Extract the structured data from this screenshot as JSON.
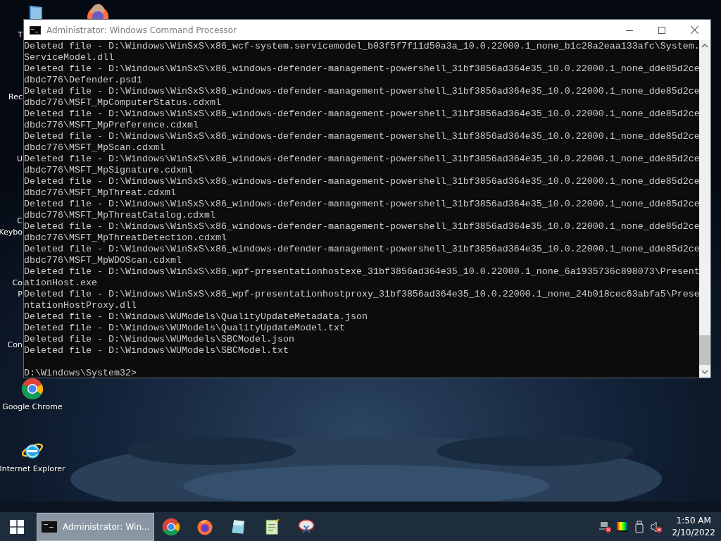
{
  "desktop_icons": [
    {
      "kind": "covered-pc",
      "label_lines": [
        "T"
      ]
    },
    {
      "kind": "covered",
      "label_lines": [
        "Rec"
      ]
    },
    {
      "kind": "covered",
      "label_lines": [
        "U"
      ]
    },
    {
      "kind": "covered",
      "label_lines": [
        "C",
        "Keybo"
      ]
    },
    {
      "kind": "covered",
      "label_lines": [
        "Co",
        "P"
      ]
    },
    {
      "kind": "covered",
      "label_lines": [
        "Con"
      ]
    },
    {
      "kind": "chrome-app",
      "label_lines": [
        "Google Chrome"
      ]
    },
    {
      "kind": "ie-app",
      "label_lines": [
        "Internet Explorer"
      ]
    }
  ],
  "window": {
    "title": "Administrator: Windows Command Processor",
    "lines": [
      "Deleted file - D:\\Windows\\WinSxS\\x86_wcf-system.servicemodel_b03f5f7f11d50a3a_10.0.22000.1_none_b1c28a2eaa133afc\\System.",
      "ServiceModel.dll",
      "Deleted file - D:\\Windows\\WinSxS\\x86_windows-defender-management-powershell_31bf3856ad364e35_10.0.22000.1_none_dde85d2ce",
      "dbdc776\\Defender.psd1",
      "Deleted file - D:\\Windows\\WinSxS\\x86_windows-defender-management-powershell_31bf3856ad364e35_10.0.22000.1_none_dde85d2ce",
      "dbdc776\\MSFT_MpComputerStatus.cdxml",
      "Deleted file - D:\\Windows\\WinSxS\\x86_windows-defender-management-powershell_31bf3856ad364e35_10.0.22000.1_none_dde85d2ce",
      "dbdc776\\MSFT_MpPreference.cdxml",
      "Deleted file - D:\\Windows\\WinSxS\\x86_windows-defender-management-powershell_31bf3856ad364e35_10.0.22000.1_none_dde85d2ce",
      "dbdc776\\MSFT_MpScan.cdxml",
      "Deleted file - D:\\Windows\\WinSxS\\x86_windows-defender-management-powershell_31bf3856ad364e35_10.0.22000.1_none_dde85d2ce",
      "dbdc776\\MSFT_MpSignature.cdxml",
      "Deleted file - D:\\Windows\\WinSxS\\x86_windows-defender-management-powershell_31bf3856ad364e35_10.0.22000.1_none_dde85d2ce",
      "dbdc776\\MSFT_MpThreat.cdxml",
      "Deleted file - D:\\Windows\\WinSxS\\x86_windows-defender-management-powershell_31bf3856ad364e35_10.0.22000.1_none_dde85d2ce",
      "dbdc776\\MSFT_MpThreatCatalog.cdxml",
      "Deleted file - D:\\Windows\\WinSxS\\x86_windows-defender-management-powershell_31bf3856ad364e35_10.0.22000.1_none_dde85d2ce",
      "dbdc776\\MSFT_MpThreatDetection.cdxml",
      "Deleted file - D:\\Windows\\WinSxS\\x86_windows-defender-management-powershell_31bf3856ad364e35_10.0.22000.1_none_dde85d2ce",
      "dbdc776\\MSFT_MpWDOScan.cdxml",
      "Deleted file - D:\\Windows\\WinSxS\\x86_wpf-presentationhostexe_31bf3856ad364e35_10.0.22000.1_none_6a1935736c898073\\Present",
      "ationHost.exe",
      "Deleted file - D:\\Windows\\WinSxS\\x86_wpf-presentationhostproxy_31bf3856ad364e35_10.0.22000.1_none_24b018cec63abfa5\\Prese",
      "ntationHostProxy.dll",
      "Deleted file - D:\\Windows\\WUModels\\QualityUpdateMetadata.json",
      "Deleted file - D:\\Windows\\WUModels\\QualityUpdateModel.txt",
      "Deleted file - D:\\Windows\\WUModels\\SBCModel.json",
      "Deleted file - D:\\Windows\\WUModels\\SBCModel.txt"
    ],
    "prompt": "D:\\Windows\\System32>"
  },
  "taskbar": {
    "tasks": [
      {
        "label": "Administrator: Win...",
        "selected": true
      }
    ],
    "clock": {
      "time": "1:50 AM",
      "date": "2/10/2022"
    }
  }
}
